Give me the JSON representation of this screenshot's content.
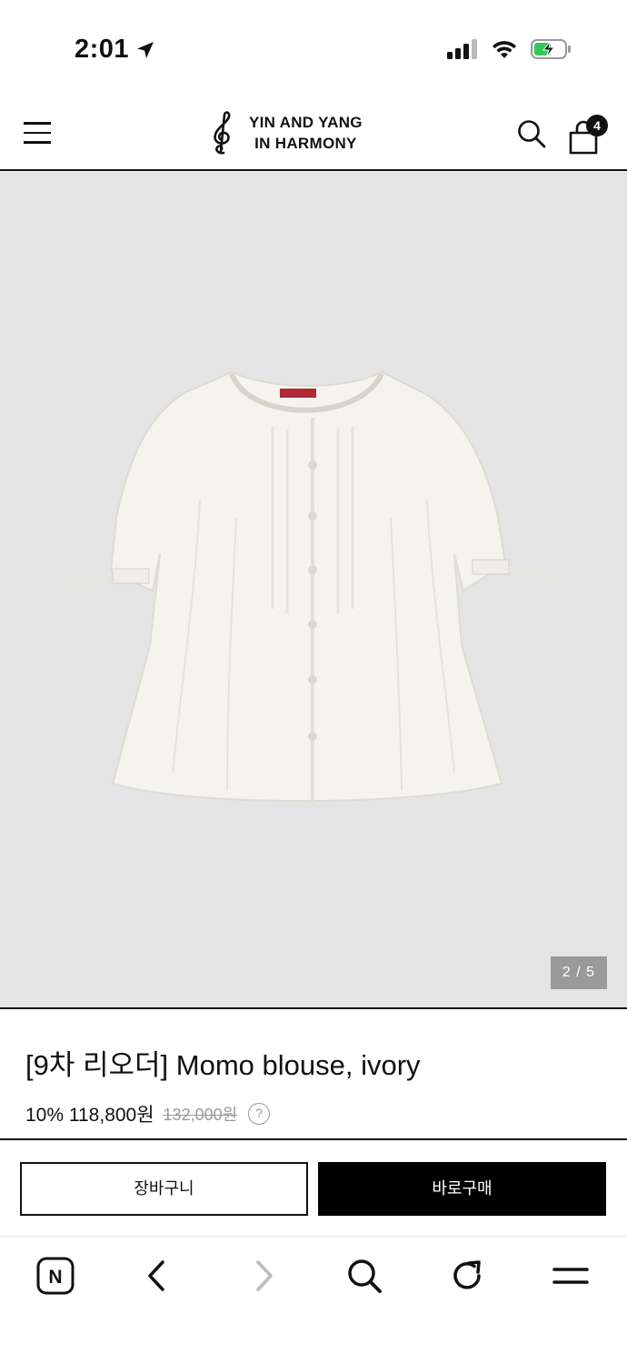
{
  "status_bar": {
    "time": "2:01"
  },
  "header": {
    "brand_line1": "YIN AND YANG",
    "brand_line2": "IN HARMONY",
    "cart_count": "4"
  },
  "gallery": {
    "counter": "2 / 5"
  },
  "product": {
    "title": "[9차 리오더] Momo blouse, ivory",
    "discount": "10%",
    "price": "118,800원",
    "original_price": "132,000원",
    "help": "?"
  },
  "actions": {
    "cart_label": "장바구니",
    "buy_label": "바로구매"
  },
  "browser_toolbar": {
    "home_letter": "N"
  },
  "colors": {
    "image_background": "#e4e4e4",
    "primary": "#000000",
    "muted": "#999999"
  },
  "icons": [
    "location-arrow-icon",
    "signal-icon",
    "wifi-icon",
    "battery-charging-icon",
    "hamburger-menu-icon",
    "treble-clef-logo-icon",
    "search-icon",
    "shopping-bag-icon",
    "help-icon",
    "naver-home-icon",
    "back-icon",
    "forward-icon",
    "browser-search-icon",
    "reload-icon",
    "browser-menu-icon"
  ]
}
